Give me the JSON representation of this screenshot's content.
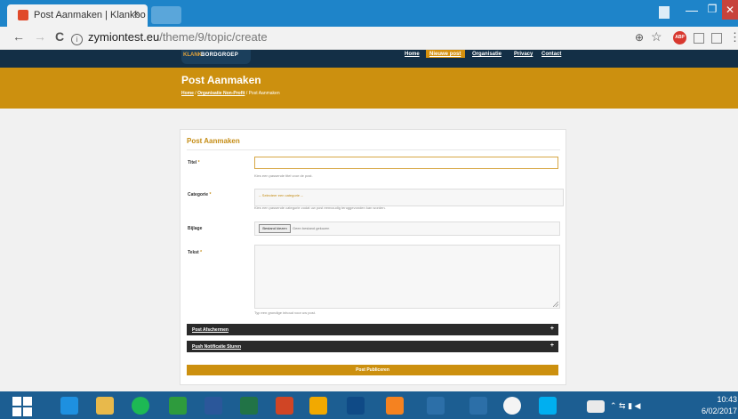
{
  "browser": {
    "tab_title": "Post Aanmaken | Klankbo",
    "tab_close": "×",
    "url_host": "zymiontest.eu",
    "url_path": "/theme/9/topic/create",
    "back": "←",
    "forward": "→",
    "reload": "C",
    "zoom_icon": "⊕",
    "star_icon": "☆",
    "menu_icon": "⋮",
    "abp_label": "ABP",
    "win_min": "—",
    "win_max": "❐",
    "win_close": "✕"
  },
  "site": {
    "logo_part1": "KLANK",
    "logo_part2": "BORDGROEP",
    "nav": [
      "Home",
      "Nieuwe post",
      "Organisatie",
      "Privacy",
      "Contact"
    ],
    "page_title": "Post Aanmaken",
    "breadcrumb": {
      "home": "Home",
      "sep": "/",
      "section": "Organisatie Non-Profit",
      "current": "Post Aanmaken"
    }
  },
  "form": {
    "heading": "Post Aanmaken",
    "title_label": "Titel",
    "required_mark": "*",
    "title_value": "",
    "title_help": "Kies een passende titel voor de post.",
    "category_label": "Categorie",
    "category_value": "-- Selecteer een categorie --",
    "category_help": "Kies een passende categorie zodat uw post eenvoudig teruggevonden kan worden.",
    "attachment_label": "Bijlage",
    "file_button": "Bestand kiezen",
    "file_status": "Geen bestand gekozen",
    "text_label": "Tekst",
    "text_help": "Typ een grondige inhoud voor uw post.",
    "section1": "Post Afschermen",
    "section2": "Push Notificatie Sturen",
    "expand": "+",
    "submit": "Post Publiceren"
  },
  "taskbar": {
    "time": "10:43",
    "date": "6/02/2017"
  }
}
